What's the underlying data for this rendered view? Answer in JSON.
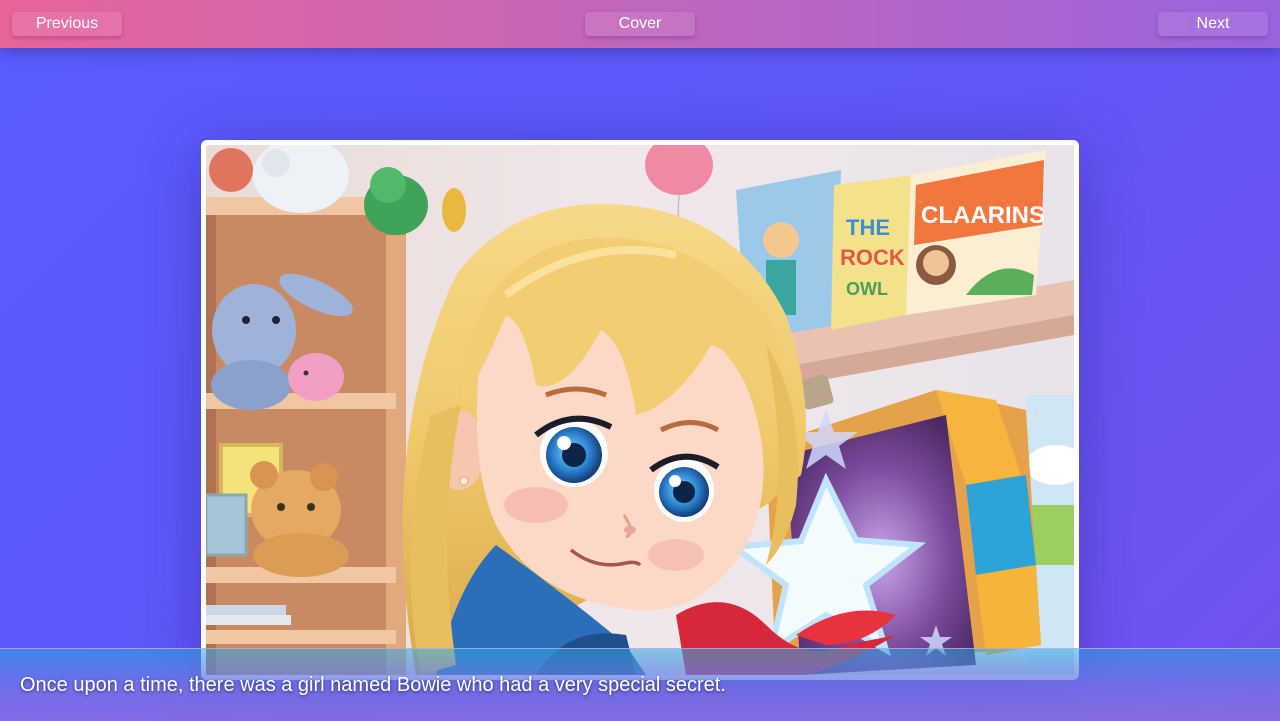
{
  "nav": {
    "previous_label": "Previous",
    "cover_label": "Cover",
    "next_label": "Next"
  },
  "story": {
    "caption": "Once upon a time, there was a girl named Bowie who had a very special secret."
  },
  "colors": {
    "background": "#5a5cff",
    "topbar_start": "#e8649a",
    "topbar_end": "#9a63dd",
    "caption_text": "#ffffff"
  }
}
